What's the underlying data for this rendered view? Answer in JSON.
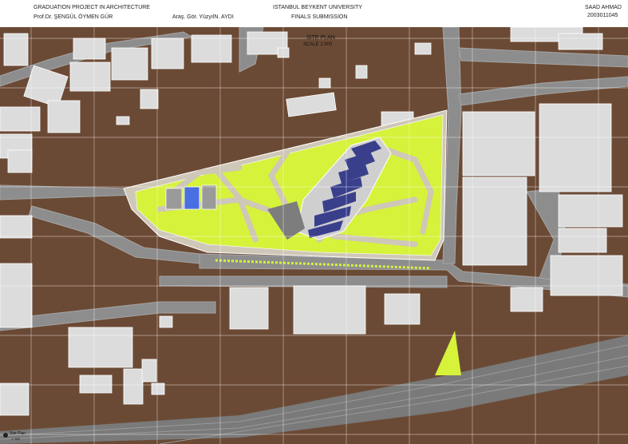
{
  "header": {
    "course": "GRADUATION PROJECT IN ARCHITECTURE",
    "instructor": "Prof.Dr. ŞENGÜL ÖYMEN GÜR",
    "assistant": "Araş. Gör. YüzyılN. AYDI",
    "university": "ISTANBUL BEYKENT UNIVERSITY",
    "submission": "FINALS SUBMISSION",
    "student_name": "SAAD AHMAD",
    "student_id": "2003011045"
  },
  "plan": {
    "title": "SITE PLAN",
    "scale": "SCALE 1:500",
    "corner_title": "Site Plan",
    "corner_scale": "1: 500"
  },
  "colors": {
    "ground": "#6b4a35",
    "road": "#8d8d8d",
    "building": "#dcdcdc",
    "lawn": "#d6f23a",
    "paving": "#cfc7b8",
    "solar": "#3a3f8c",
    "grid": "#ffffff"
  }
}
